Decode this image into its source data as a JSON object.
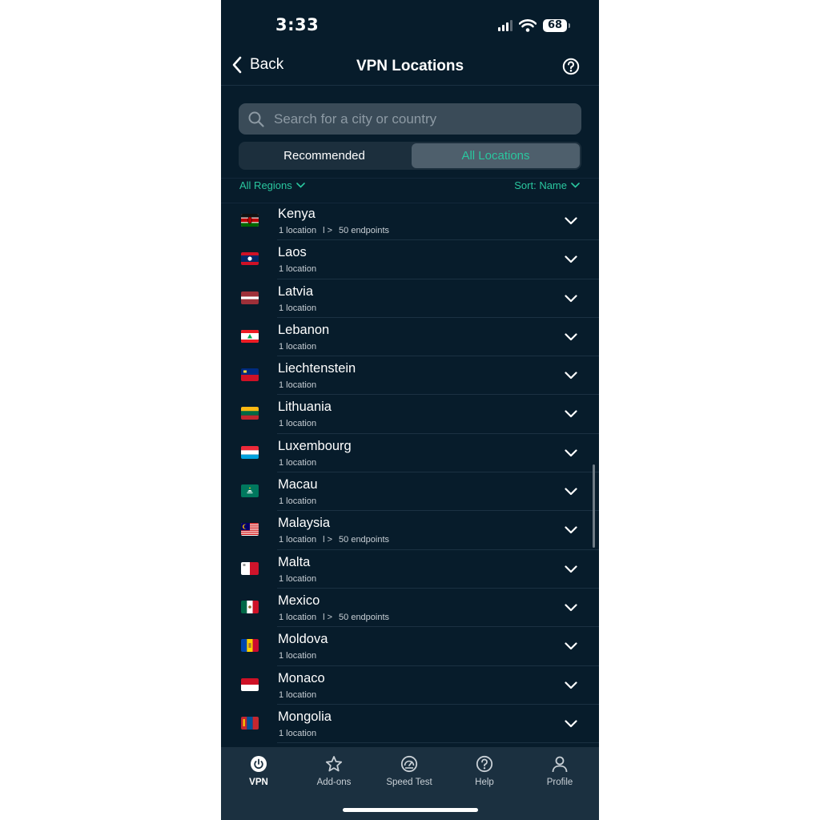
{
  "status_bar": {
    "time": "3:33",
    "battery": "68"
  },
  "nav": {
    "back_label": "Back",
    "title": "VPN Locations"
  },
  "search": {
    "placeholder": "Search for a city or country"
  },
  "segments": {
    "left": "Recommended",
    "right": "All Locations",
    "selected": "All Locations"
  },
  "filters": {
    "region": "All Regions",
    "sort": "Sort: Name"
  },
  "colors": {
    "background": "#071c2b",
    "accent": "#2ac79f",
    "tabbar": "#1b3040"
  },
  "countries": [
    {
      "name": "Kenya",
      "sub": "1 location",
      "endpoints": "50 endpoints",
      "flag": "kenya-flag"
    },
    {
      "name": "Laos",
      "sub": "1 location",
      "endpoints": "",
      "flag": "laos-flag"
    },
    {
      "name": "Latvia",
      "sub": "1 location",
      "endpoints": "",
      "flag": "latvia-flag"
    },
    {
      "name": "Lebanon",
      "sub": "1 location",
      "endpoints": "",
      "flag": "lebanon-flag"
    },
    {
      "name": "Liechtenstein",
      "sub": "1 location",
      "endpoints": "",
      "flag": "liechtenstein-flag"
    },
    {
      "name": "Lithuania",
      "sub": "1 location",
      "endpoints": "",
      "flag": "lithuania-flag"
    },
    {
      "name": "Luxembourg",
      "sub": "1 location",
      "endpoints": "",
      "flag": "luxembourg-flag"
    },
    {
      "name": "Macau",
      "sub": "1 location",
      "endpoints": "",
      "flag": "macau-flag"
    },
    {
      "name": "Malaysia",
      "sub": "1 location",
      "endpoints": "50 endpoints",
      "flag": "malaysia-flag"
    },
    {
      "name": "Malta",
      "sub": "1 location",
      "endpoints": "",
      "flag": "malta-flag"
    },
    {
      "name": "Mexico",
      "sub": "1 location",
      "endpoints": "50 endpoints",
      "flag": "mexico-flag"
    },
    {
      "name": "Moldova",
      "sub": "1 location",
      "endpoints": "",
      "flag": "moldova-flag"
    },
    {
      "name": "Monaco",
      "sub": "1 location",
      "endpoints": "",
      "flag": "monaco-flag"
    },
    {
      "name": "Mongolia",
      "sub": "1 location",
      "endpoints": "",
      "flag": "mongolia-flag"
    }
  ],
  "tabs": [
    {
      "label": "VPN",
      "icon": "power-icon",
      "active": true
    },
    {
      "label": "Add-ons",
      "icon": "star-icon",
      "active": false
    },
    {
      "label": "Speed Test",
      "icon": "speedometer-icon",
      "active": false
    },
    {
      "label": "Help",
      "icon": "help-icon",
      "active": false
    },
    {
      "label": "Profile",
      "icon": "profile-icon",
      "active": false
    }
  ]
}
